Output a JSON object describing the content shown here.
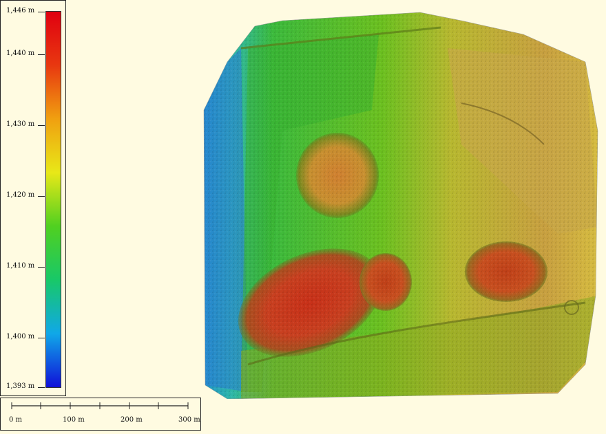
{
  "legend": {
    "ticks": [
      {
        "label": "1,446 m",
        "value": 1446
      },
      {
        "label": "1,440 m",
        "value": 1440
      },
      {
        "label": "1,430 m",
        "value": 1430
      },
      {
        "label": "1,420 m",
        "value": 1420
      },
      {
        "label": "1,410 m",
        "value": 1410
      },
      {
        "label": "1,400 m",
        "value": 1400
      },
      {
        "label": "1,393 m",
        "value": 1393
      }
    ],
    "colors": [
      "#1010d8",
      "#10a8e8",
      "#18c868",
      "#50d020",
      "#e8e818",
      "#f0a010",
      "#e83810",
      "#e00010"
    ]
  },
  "scale_bar": {
    "labels": [
      "0 m",
      "100 m",
      "200 m",
      "300 m"
    ]
  }
}
